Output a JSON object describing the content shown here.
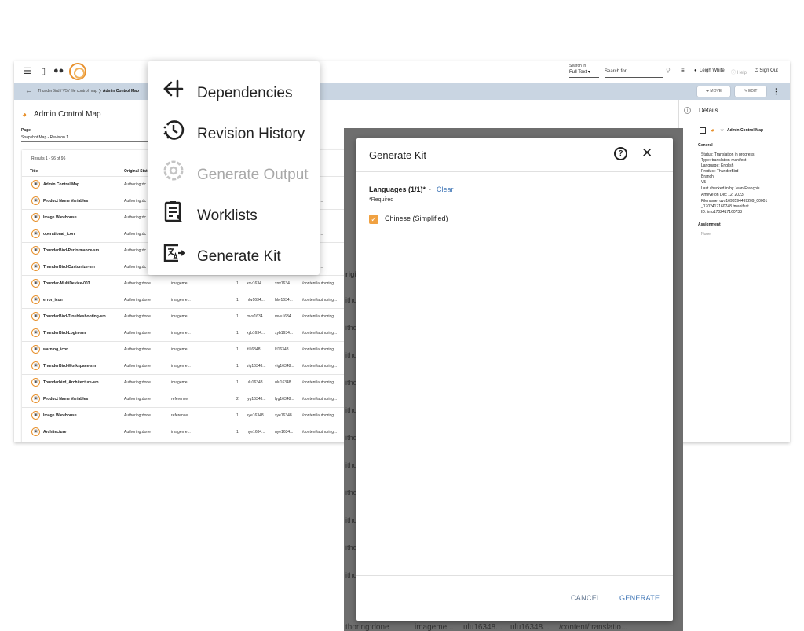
{
  "topbar": {
    "search_in_label": "Search in",
    "search_in_value": "Full Text",
    "search_placeholder": "Search for",
    "user": "Leigh White",
    "help": "Help",
    "sign_out": "Sign Out"
  },
  "breadcrumb": {
    "path": "ThunderBird / V5 / file control map",
    "current": "Admin Control Map",
    "move": "MOVE",
    "edit": "EDIT"
  },
  "page": {
    "title": "Admin Control Map",
    "field_label": "Page",
    "field_value": "Snapshot Map - Revision 1"
  },
  "table": {
    "results": "Results 1 - 96 of 96",
    "headers": [
      "Title",
      "Original Stat"
    ],
    "rows": [
      {
        "title": "Admin Control Map",
        "status": "Authoring:dc",
        "type": "",
        "n": "",
        "id1": "",
        "id2": "",
        "path": "/authoring..."
      },
      {
        "title": "Product Name Variables",
        "status": "Authoring:dc",
        "type": "",
        "n": "",
        "id1": "",
        "id2": "",
        "path": "/authoring..."
      },
      {
        "title": "Image Warehouse",
        "status": "Authoring:dc",
        "type": "",
        "n": "",
        "id1": "",
        "id2": "",
        "path": "/authoring..."
      },
      {
        "title": "operational_icon",
        "status": "Authoring:dc",
        "type": "",
        "n": "",
        "id1": "",
        "id2": "",
        "path": "/authoring..."
      },
      {
        "title": "ThunderBird-Performance-sm",
        "status": "Authoring:dc",
        "type": "",
        "n": "",
        "id1": "",
        "id2": "",
        "path": "/authoring..."
      },
      {
        "title": "ThunderBird-Customize-sm",
        "status": "Authoring:dc",
        "type": "",
        "n": "",
        "id1": "",
        "id2": "",
        "path": "/authoring..."
      },
      {
        "title": "Thunder-MultiDevice-003",
        "status": "Authoring:done",
        "type": "imageme...",
        "n": "1",
        "id1": "xnv1634...",
        "id2": "xnv1634...",
        "path": "/content/authoring..."
      },
      {
        "title": "error_icon",
        "status": "Authoring:done",
        "type": "imageme...",
        "n": "1",
        "id1": "hlw1634...",
        "id2": "hlw1634...",
        "path": "/content/authoring..."
      },
      {
        "title": "ThunderBird-Troubleshooting-sm",
        "status": "Authoring:done",
        "type": "imageme...",
        "n": "1",
        "id1": "mvu1634...",
        "id2": "mvu1634...",
        "path": "/content/authoring..."
      },
      {
        "title": "ThunderBird-Login-sm",
        "status": "Authoring:done",
        "type": "imageme...",
        "n": "1",
        "id1": "xyb1634...",
        "id2": "xyb1634...",
        "path": "/content/authoring..."
      },
      {
        "title": "warning_icon",
        "status": "Authoring:done",
        "type": "imageme...",
        "n": "1",
        "id1": "ltl16348...",
        "id2": "ltl16348...",
        "path": "/content/authoring..."
      },
      {
        "title": "ThunderBird-Workspace-sm",
        "status": "Authoring:done",
        "type": "imageme...",
        "n": "1",
        "id1": "vig16348...",
        "id2": "vig16348...",
        "path": "/content/authoring..."
      },
      {
        "title": "Thunderbird_Architecture-sm",
        "status": "Authoring:done",
        "type": "imageme...",
        "n": "1",
        "id1": "ulu16348...",
        "id2": "ulu16348...",
        "path": "/content/authoring..."
      },
      {
        "title": "Product Name Variables",
        "status": "Authoring:done",
        "type": "reference",
        "n": "2",
        "id1": "lyg16348...",
        "id2": "lyg16348...",
        "path": "/content/authoring..."
      },
      {
        "title": "Image Warehouse",
        "status": "Authoring:done",
        "type": "reference",
        "n": "1",
        "id1": "sye16348...",
        "id2": "sye16348...",
        "path": "/content/authoring..."
      },
      {
        "title": "Architecture",
        "status": "Authoring:done",
        "type": "imageme...",
        "n": "1",
        "id1": "nye1634...",
        "id2": "nye1634...",
        "path": "/content/authoring..."
      }
    ]
  },
  "details": {
    "title": "Details",
    "item": "Admin Control Map",
    "general": "General",
    "status": "Status: Translation in progress",
    "type": "Type: translation-manifest",
    "language": "Language: English",
    "product": "Product: ThunderBird",
    "branch": "Branch:",
    "branch_value": "V5",
    "checked_in": "Last checked in by Jean-François",
    "checked_in_2": "Ameye on Dec 12, 2023",
    "filename": "Filename: uvo1693594499209_00001",
    "filename_2": "_1702417160748.tmanifest",
    "id": "ID: imu1702417160733",
    "assignment": "Assignment",
    "assignment_value": "None"
  },
  "menu": {
    "items": [
      {
        "label": "Dependencies",
        "icon": "arrow-split-icon",
        "disabled": false
      },
      {
        "label": "Revision History",
        "icon": "history-icon",
        "disabled": false
      },
      {
        "label": "Generate Output",
        "icon": "gear-icon",
        "disabled": true
      },
      {
        "label": "Worklists",
        "icon": "clipboard-list-icon",
        "disabled": false
      },
      {
        "label": "Generate Kit",
        "icon": "translate-icon",
        "disabled": false
      }
    ]
  },
  "background_peek": {
    "header_fragment": "rigin",
    "row_fragment": "itho",
    "bottom_row": [
      "thoring:done",
      "imageme...",
      "ulu16348...",
      "ulu16348...",
      "/content/translatio..."
    ]
  },
  "dialog": {
    "title": "Generate Kit",
    "languages_label": "Languages (1/1)*",
    "separator": "-",
    "clear": "Clear",
    "required": "*Required",
    "option": "Chinese (Simplified)",
    "cancel": "CANCEL",
    "generate": "GENERATE"
  },
  "colors": {
    "accent_orange": "#f0a141",
    "link_blue": "#3d74b5",
    "breadcrumb_bar": "#c9d5e2",
    "overlay": "#6e6e6e"
  }
}
